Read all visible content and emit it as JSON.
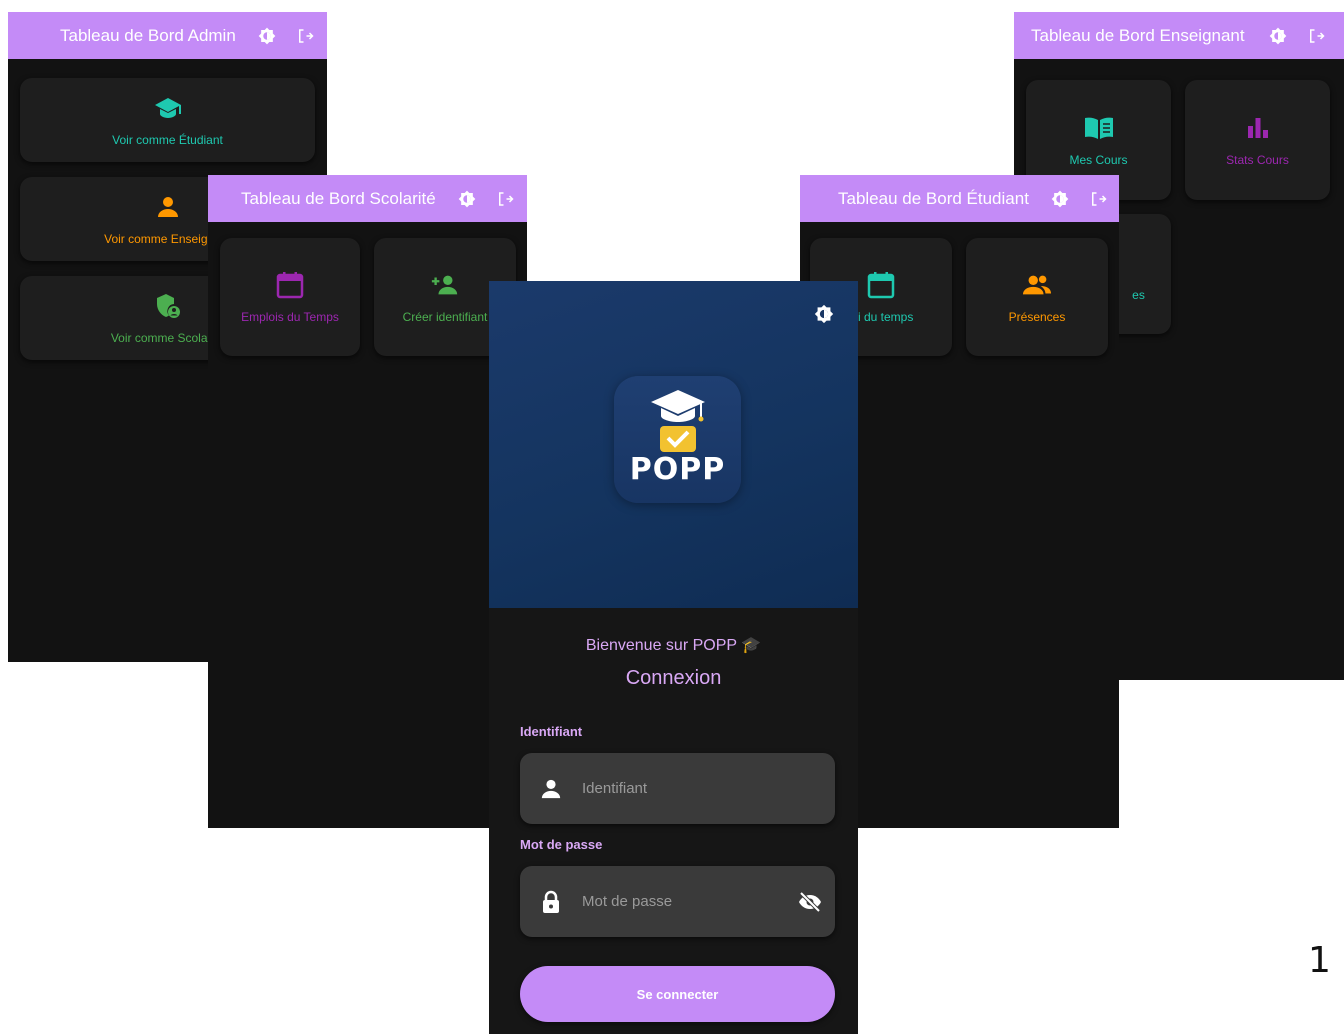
{
  "admin": {
    "title": "Tableau de Bord Admin",
    "cards": [
      {
        "label": "Voir comme Étudiant",
        "icon": "graduation-cap-icon",
        "color": "#1ec9b0"
      },
      {
        "label": "Voir comme Enseignant",
        "icon": "person-icon",
        "color": "#ff9800"
      },
      {
        "label": "Voir comme Scolarité",
        "icon": "admin-shield-icon",
        "color": "#4caf50"
      }
    ]
  },
  "enseignant": {
    "title": "Tableau de Bord Enseignant",
    "cards": [
      {
        "label": "Mes Cours",
        "icon": "book-icon",
        "color": "#1ec9b0"
      },
      {
        "label": "Stats Cours",
        "icon": "bar-chart-icon",
        "color": "#9c27b0"
      },
      {
        "label": "es",
        "icon": "",
        "color": "#1ec9b0"
      }
    ]
  },
  "scolarite": {
    "title": "Tableau de Bord Scolarité",
    "cards": [
      {
        "label": "Emplois du Temps",
        "icon": "calendar-icon",
        "color": "#9c27b0"
      },
      {
        "label": "Créer identifiant",
        "icon": "add-person-icon",
        "color": "#4caf50"
      }
    ]
  },
  "etudiant": {
    "title": "Tableau de Bord Étudiant",
    "cards": [
      {
        "label": "loi du temps",
        "icon": "calendar-icon",
        "color": "#1ec9b0"
      },
      {
        "label": "Présences",
        "icon": "group-icon",
        "color": "#ff9800"
      }
    ]
  },
  "login": {
    "logo_text": "POPP",
    "welcome": "Bienvenue sur POPP 🎓",
    "heading": "Connexion",
    "username_label": "Identifiant",
    "username_placeholder": "Identifiant",
    "password_label": "Mot de passe",
    "password_placeholder": "Mot de passe",
    "submit_label": "Se connecter"
  },
  "page_number": "1",
  "colors": {
    "appbar": "#c48bf7",
    "background": "#121212",
    "card": "#1e1e1e",
    "accent_text": "#d9a8f5"
  }
}
